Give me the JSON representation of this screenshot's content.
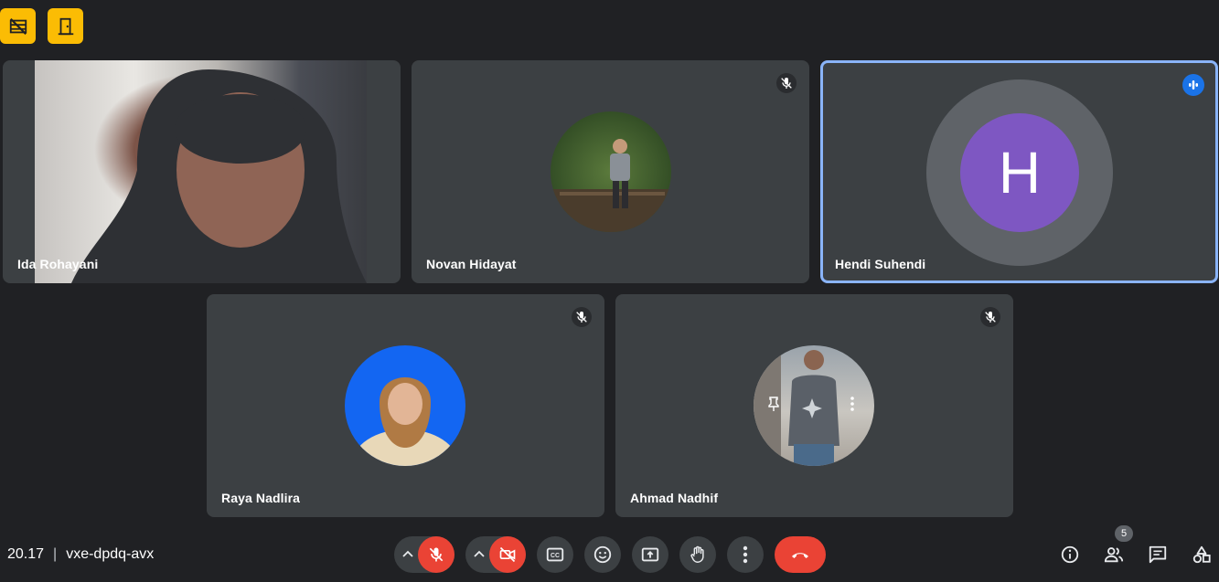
{
  "participants": [
    {
      "name": "Ida Rohayani"
    },
    {
      "name": "Novan Hidayat"
    },
    {
      "name": "Hendi Suhendi",
      "initial": "H"
    },
    {
      "name": "Raya Nadlira"
    },
    {
      "name": "Ahmad Nadhif"
    }
  ],
  "meeting": {
    "time": "20.17",
    "separator": "|",
    "code": "vxe-dpdq-avx"
  },
  "people_count": "5",
  "colors": {
    "background": "#202124",
    "tile": "#3c4043",
    "accent": "#fbbc04",
    "danger": "#ea4335",
    "active_border": "#8ab4f8",
    "avatar_purple": "#7e57c2"
  },
  "icons": {
    "top_left": [
      "no-video-grid-icon",
      "door-icon"
    ],
    "controls": [
      "mic-off-icon",
      "videocam-off-icon",
      "closed-caption-icon",
      "emoji-icon",
      "present-screen-icon",
      "raise-hand-icon",
      "more-vert-icon",
      "call-end-icon"
    ],
    "right": [
      "info-icon",
      "people-icon",
      "chat-icon",
      "activities-icon"
    ]
  }
}
